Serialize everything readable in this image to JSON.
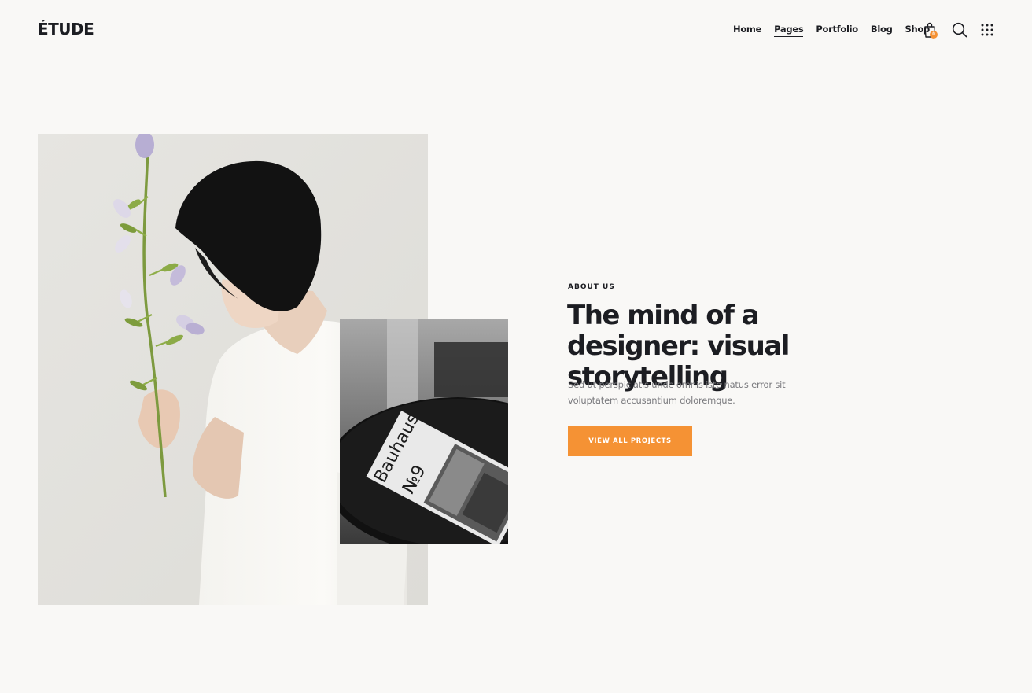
{
  "brand": {
    "logo": "ÉTUDE"
  },
  "nav": {
    "items": [
      {
        "label": "Home",
        "active": false
      },
      {
        "label": "Pages",
        "active": true
      },
      {
        "label": "Portfolio",
        "active": false
      },
      {
        "label": "Blog",
        "active": false
      },
      {
        "label": "Shop",
        "active": false
      }
    ]
  },
  "header_icons": {
    "cart": {
      "icon": "shopping-bag-icon",
      "count": "0"
    },
    "search": {
      "icon": "search-icon"
    },
    "menu": {
      "icon": "grid-menu-icon"
    }
  },
  "hero": {
    "main_image": {
      "icon": "person-with-flowers-photo"
    },
    "secondary_image": {
      "icon": "bauhaus-magazine-photo"
    },
    "eyebrow": "ABOUT US",
    "headline": "The mind of a designer: visual storytelling",
    "body": "Sed ut perspiciatis unde omnis iste natus error sit voluptatem accusantium doloremque.",
    "cta_label": "VIEW ALL PROJECTS"
  },
  "colors": {
    "background": "#f9f8f6",
    "text": "#1c1d22",
    "accent": "#f59234",
    "muted": "#7a7a7e"
  }
}
